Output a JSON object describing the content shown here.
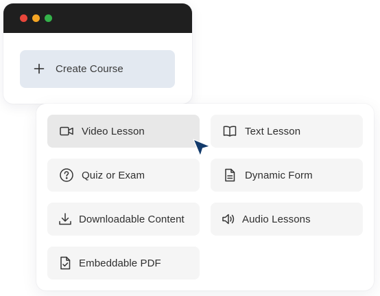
{
  "window": {
    "traffic_lights": [
      {
        "name": "close",
        "color": "#e8463b"
      },
      {
        "name": "minimize",
        "color": "#f5a524"
      },
      {
        "name": "maximize",
        "color": "#34b24a"
      }
    ],
    "create_button": {
      "icon": "plus-icon",
      "label": "Create Course"
    }
  },
  "menu": {
    "items": [
      {
        "label": "Video Lesson",
        "icon": "video-camera-icon",
        "state": "hovered"
      },
      {
        "label": "Text Lesson",
        "icon": "open-book-icon"
      },
      {
        "label": "Quiz or Exam",
        "icon": "question-circle-icon"
      },
      {
        "label": "Dynamic Form",
        "icon": "document-icon"
      },
      {
        "label": "Downloadable Content",
        "icon": "download-icon"
      },
      {
        "label": "Audio Lessons",
        "icon": "speaker-icon"
      },
      {
        "label": "Embeddable PDF",
        "icon": "file-check-icon"
      }
    ]
  },
  "colors": {
    "titlebar": "#1f1f1f",
    "create_button_bg": "#e3e9f1",
    "item_bg": "#f5f5f5",
    "item_hover_bg": "#e8e8e8",
    "cursor": "#123a6b"
  }
}
